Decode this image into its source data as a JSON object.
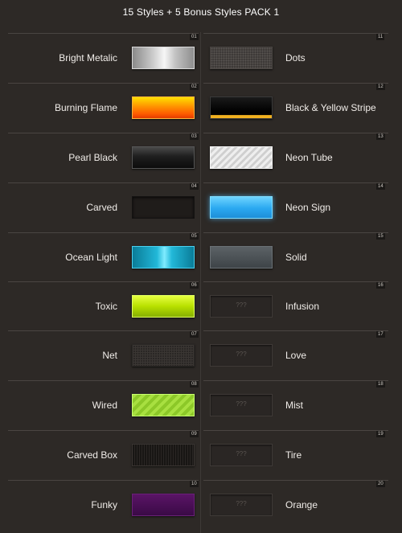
{
  "page": {
    "title": "15 Styles + 5 Bonus Styles PACK 1"
  },
  "rows": [
    {
      "left": {
        "num": "01",
        "label": "Bright Metalic",
        "style": "bright-metalic"
      },
      "right": {
        "num": "11",
        "label": "Dots",
        "style": "dots"
      }
    },
    {
      "left": {
        "num": "02",
        "label": "Burning Flame",
        "style": "burning-flame"
      },
      "right": {
        "num": "12",
        "label": "Black & Yellow Stripe",
        "style": "black-yellow-stripe"
      }
    },
    {
      "left": {
        "num": "03",
        "label": "Pearl Black",
        "style": "pearl-black"
      },
      "right": {
        "num": "13",
        "label": "Neon Tube",
        "style": "neon-tube"
      }
    },
    {
      "left": {
        "num": "04",
        "label": "Carved",
        "style": "carved"
      },
      "right": {
        "num": "14",
        "label": "Neon Sign",
        "style": "neon-sign"
      }
    },
    {
      "left": {
        "num": "05",
        "label": "Ocean Light",
        "style": "ocean-light"
      },
      "right": {
        "num": "15",
        "label": "Solid",
        "style": "solid"
      }
    },
    {
      "left": {
        "num": "06",
        "label": "Toxic",
        "style": "toxic"
      },
      "right": {
        "num": "16",
        "label": "Infusion",
        "style": "locked",
        "placeholder": "???"
      }
    },
    {
      "left": {
        "num": "07",
        "label": "Net",
        "style": "net"
      },
      "right": {
        "num": "17",
        "label": "Love",
        "style": "locked",
        "placeholder": "???"
      }
    },
    {
      "left": {
        "num": "08",
        "label": "Wired",
        "style": "wired"
      },
      "right": {
        "num": "18",
        "label": "Mist",
        "style": "locked",
        "placeholder": "???"
      }
    },
    {
      "left": {
        "num": "09",
        "label": "Carved Box",
        "style": "carved-box"
      },
      "right": {
        "num": "19",
        "label": "Tire",
        "style": "locked",
        "placeholder": "???"
      }
    },
    {
      "left": {
        "num": "10",
        "label": "Funky",
        "style": "funky"
      },
      "right": {
        "num": "20",
        "label": "Orange",
        "style": "locked",
        "placeholder": "???"
      }
    }
  ],
  "colors": {
    "background": "#2d2926",
    "divider": "#4a4542",
    "text": "#f0ece8"
  }
}
